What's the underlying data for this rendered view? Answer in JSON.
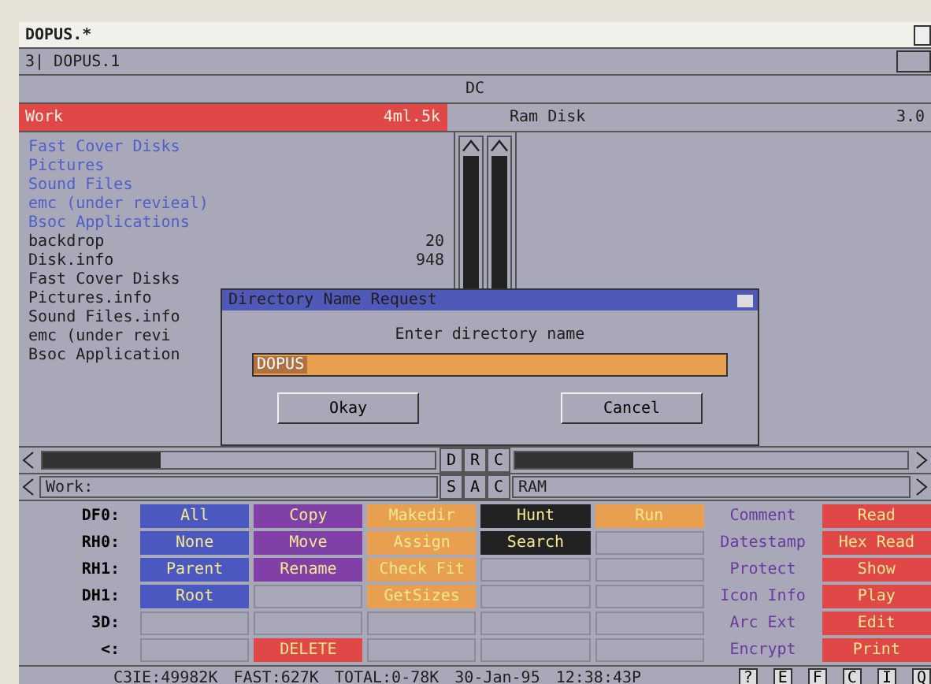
{
  "window": {
    "title": "DOPUS.*"
  },
  "screen_bar": {
    "number": "3|",
    "title": "DOPUS.1"
  },
  "info_bar": {
    "text": "DC"
  },
  "left_panel": {
    "path": "Work",
    "size": "4ml.5k",
    "active": true,
    "entries": [
      {
        "name": "Fast Cover Disks",
        "kind": "dir"
      },
      {
        "name": "Pictures",
        "kind": "dir"
      },
      {
        "name": "Sound Files",
        "kind": "dir"
      },
      {
        "name": "emc (under revieal)",
        "kind": "dir"
      },
      {
        "name": "Bsoc Applications",
        "kind": "dir"
      },
      {
        "name": " backdrop",
        "size": "20",
        "kind": "file"
      },
      {
        "name": "Disk.info",
        "size": "948",
        "kind": "file"
      },
      {
        "name": "Fast Cover Disks",
        "kind": "file"
      },
      {
        "name": "Pictures.info",
        "kind": "file"
      },
      {
        "name": "Sound Files.info",
        "kind": "file"
      },
      {
        "name": " emc (under revi",
        "kind": "file"
      },
      {
        "name": "Bsoc Application",
        "kind": "file"
      }
    ],
    "path_field": "Work:"
  },
  "right_panel": {
    "path": "Ram Disk",
    "size": "3.0",
    "active": false,
    "path_field": "RAM"
  },
  "middle_buttons": [
    [
      "D",
      "R",
      "C"
    ],
    [
      "S",
      "A",
      "C"
    ]
  ],
  "dialog": {
    "title": "Directory Name Request",
    "prompt": "Enter directory name",
    "value": "DOPUS",
    "buttons": [
      "Okay",
      "Cancel"
    ]
  },
  "devices": [
    "DF0:",
    "RH0:",
    "RH1:",
    "DH1:",
    "3D:",
    "<:"
  ],
  "button_rows": [
    [
      {
        "kind": "button",
        "label": "All",
        "color": "#4a58c0"
      },
      {
        "kind": "button",
        "label": "Copy",
        "color": "#8040a8"
      },
      {
        "kind": "button",
        "label": "Makedir",
        "color": "#e8a050"
      },
      {
        "kind": "button",
        "label": "Hunt",
        "color": "#222222"
      },
      {
        "kind": "button",
        "label": "Run",
        "color": "#e8a050"
      },
      {
        "kind": "button",
        "label": "Comment",
        "color": "#a8a8b8"
      },
      {
        "kind": "button",
        "label": "Read",
        "color": "#e04848"
      }
    ],
    [
      {
        "kind": "button",
        "label": "None",
        "color": "#4a58c0"
      },
      {
        "kind": "button",
        "label": "Move",
        "color": "#8040a8"
      },
      {
        "kind": "button",
        "label": "Assign",
        "color": "#e8a050"
      },
      {
        "kind": "button",
        "label": "Search",
        "color": "#222222"
      },
      {
        "kind": "blank"
      },
      {
        "kind": "button",
        "label": "Datestamp",
        "color": "#a8a8b8"
      },
      {
        "kind": "button",
        "label": "Hex Read",
        "color": "#e04848"
      }
    ],
    [
      {
        "kind": "button",
        "label": "Parent",
        "color": "#4a58c0"
      },
      {
        "kind": "button",
        "label": "Rename",
        "color": "#8040a8"
      },
      {
        "kind": "button",
        "label": "Check Fit",
        "color": "#e8a050"
      },
      {
        "kind": "blank"
      },
      {
        "kind": "blank"
      },
      {
        "kind": "button",
        "label": "Protect",
        "color": "#a8a8b8"
      },
      {
        "kind": "button",
        "label": "Show",
        "color": "#e04848"
      }
    ],
    [
      {
        "kind": "button",
        "label": "Root",
        "color": "#4a58c0"
      },
      {
        "kind": "blank"
      },
      {
        "kind": "button",
        "label": "GetSizes",
        "color": "#e8a050"
      },
      {
        "kind": "blank"
      },
      {
        "kind": "blank"
      },
      {
        "kind": "button",
        "label": "Icon Info",
        "color": "#a8a8b8"
      },
      {
        "kind": "button",
        "label": "Play",
        "color": "#e04848"
      }
    ],
    [
      {
        "kind": "blank"
      },
      {
        "kind": "blank"
      },
      {
        "kind": "blank"
      },
      {
        "kind": "blank"
      },
      {
        "kind": "blank"
      },
      {
        "kind": "button",
        "label": "Arc Ext",
        "color": "#a8a8b8"
      },
      {
        "kind": "button",
        "label": "Edit",
        "color": "#e04848"
      }
    ],
    [
      {
        "kind": "blank"
      },
      {
        "kind": "button",
        "label": "DELETE",
        "color": "#e04848"
      },
      {
        "kind": "blank"
      },
      {
        "kind": "blank"
      },
      {
        "kind": "blank"
      },
      {
        "kind": "button",
        "label": "Encrypt",
        "color": "#a8a8b8"
      },
      {
        "kind": "button",
        "label": "Print",
        "color": "#e04848"
      }
    ]
  ],
  "status_bar": {
    "items": [
      "C3IE:49982K",
      "FAST:627K",
      "TOTAL:0-78K",
      "30-Jan-95",
      "12:38:43P"
    ],
    "buttons": [
      "?",
      "E",
      "F",
      "C",
      "I",
      "Q"
    ]
  }
}
